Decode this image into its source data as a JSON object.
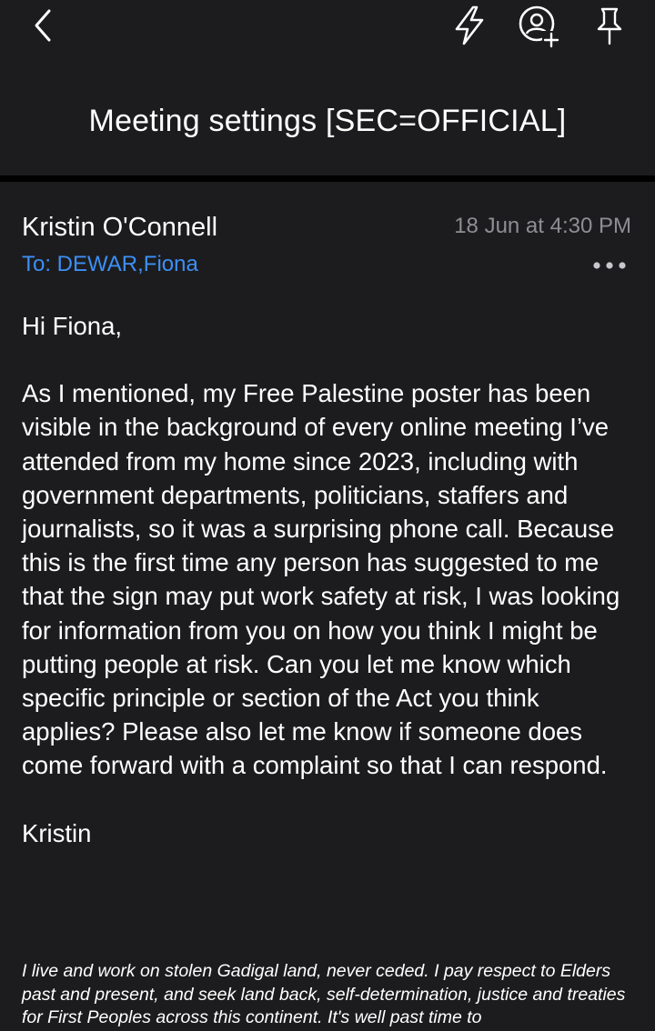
{
  "header": {
    "icons": [
      "back-icon",
      "bolt-icon",
      "contact-add-icon",
      "pin-icon"
    ],
    "subject": "Meeting settings [SEC=OFFICIAL]"
  },
  "email": {
    "sender": "Kristin O'Connell",
    "date": "18 Jun at 4:30 PM",
    "recipient": "To: DEWAR,Fiona",
    "greeting": "Hi Fiona,",
    "paragraph": "As I mentioned, my Free Palestine poster has been visible in the background of every online meeting I’ve attended from my home since 2023, including with government departments, politicians, staffers and journalists, so it was a surprising phone call. Because this is the first time any person has suggested to me that the sign may put work safety at risk, I was looking for information from you on how you think I might be putting people at risk. Can you let me know which specific principle or section of the Act you think applies? Please also let me know if someone does come forward with a complaint so that I can respond.",
    "signoff": "Kristin",
    "signature": "I live and work on stolen Gadigal land, never ceded. I pay respect to Elders past and present, and seek land back, self-determination, justice and treaties for First Peoples across this continent. It's well past time to"
  },
  "colors": {
    "background": "#1c1c1e",
    "divider": "#000000",
    "link": "#3d8ff5",
    "meta": "#8e8e93",
    "text": "#ffffff"
  }
}
